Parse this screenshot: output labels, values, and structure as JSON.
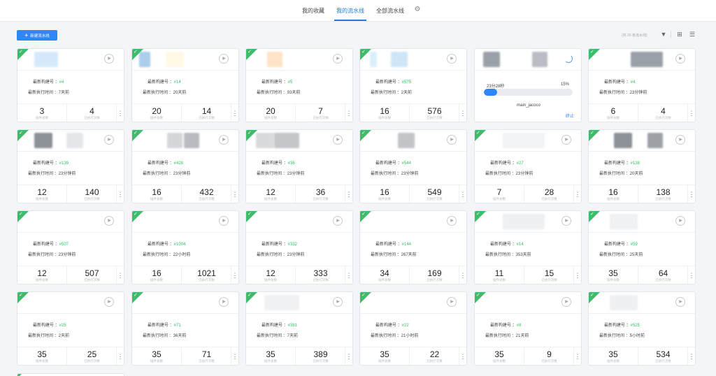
{
  "tabs": [
    {
      "label": "我的收藏",
      "active": false
    },
    {
      "label": "我的流水线",
      "active": true
    },
    {
      "label": "全部流水线",
      "active": false
    }
  ],
  "settings_icon": "gear-icon",
  "new_button": {
    "label": "新建流水线",
    "icon": "plus-icon"
  },
  "toolbar": {
    "count_text": "(共 25 条流水线)",
    "icons": [
      "filter-icon",
      "grid-view-icon",
      "list-view-icon"
    ]
  },
  "labels": {
    "build_no": "最新构建号 ：",
    "exec_time": "最新执行时间 ：",
    "plugins": "插件总数",
    "executions": "已执行次数"
  },
  "colors": {
    "accent": "#2f86f6",
    "success": "#3dbd6b",
    "build_no": "#2fbf5f"
  },
  "running_card": {
    "elapsed": "23分28秒",
    "progress_text": "15%",
    "progress": 0.15,
    "job": "main_jacoco",
    "stop_label": "终止"
  },
  "cards": [
    {
      "build": "#4",
      "time": "7天前",
      "plugins": "3",
      "executions": "4"
    },
    {
      "build": "#14",
      "time": "20天前",
      "plugins": "20",
      "executions": "14"
    },
    {
      "build": "#5",
      "time": "93天前",
      "plugins": "20",
      "executions": "7"
    },
    {
      "build": "#575",
      "time": "2天前",
      "plugins": "16",
      "executions": "576"
    },
    {
      "running": true
    },
    {
      "build": "#4",
      "time": "23分钟前",
      "plugins": "6",
      "executions": "4"
    },
    {
      "build": "#139",
      "time": "23分钟前",
      "plugins": "12",
      "executions": "140"
    },
    {
      "build": "#428",
      "time": "23分钟前",
      "plugins": "16",
      "executions": "432"
    },
    {
      "build": "#36",
      "time": "23分钟前",
      "plugins": "12",
      "executions": "36"
    },
    {
      "build": "#544",
      "time": "23分钟前",
      "plugins": "16",
      "executions": "549"
    },
    {
      "build": "#27",
      "time": "23分钟前",
      "plugins": "7",
      "executions": "28"
    },
    {
      "build": "#138",
      "time": "20天前",
      "plugins": "16",
      "executions": "138"
    },
    {
      "build": "#507",
      "time": "23分钟前",
      "plugins": "12",
      "executions": "507"
    },
    {
      "build": "#1004",
      "time": "22小时前",
      "plugins": "16",
      "executions": "1021"
    },
    {
      "build": "#332",
      "time": "23分钟前",
      "plugins": "12",
      "executions": "333"
    },
    {
      "build": "#144",
      "time": "267天前",
      "plugins": "34",
      "executions": "169"
    },
    {
      "build": "#14",
      "time": "353天前",
      "plugins": "11",
      "executions": "15"
    },
    {
      "build": "#59",
      "time": "25天前",
      "plugins": "35",
      "executions": "64"
    },
    {
      "build": "#25",
      "time": "2天前",
      "plugins": "35",
      "executions": "25"
    },
    {
      "build": "#71",
      "time": "36天前",
      "plugins": "35",
      "executions": "71"
    },
    {
      "build": "#381",
      "time": "7天前",
      "plugins": "35",
      "executions": "389"
    },
    {
      "build": "#22",
      "time": "21小时前",
      "plugins": "35",
      "executions": "22"
    },
    {
      "build": "#8",
      "time": "21天前",
      "plugins": "35",
      "executions": "9"
    },
    {
      "build": "#525",
      "time": "5小时前",
      "plugins": "35",
      "executions": "534"
    }
  ]
}
